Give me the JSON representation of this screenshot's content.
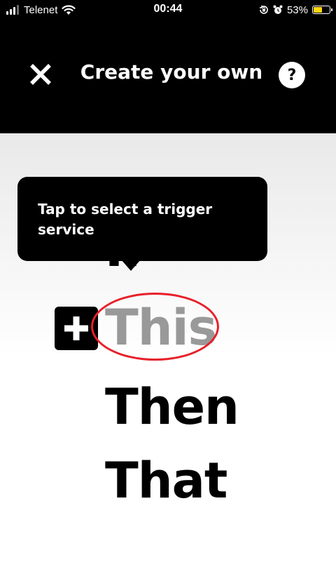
{
  "status_bar": {
    "carrier": "Telenet",
    "time": "00:44",
    "battery_percent": "53%",
    "battery_level": 0.53,
    "battery_color": "#ffd60a",
    "icons": [
      "signal-icon",
      "wifi-icon",
      "rotation-lock-icon",
      "alarm-icon",
      "battery-icon"
    ]
  },
  "header": {
    "title": "Create your own",
    "close_icon": "close-icon",
    "help_label": "?"
  },
  "applet": {
    "if_word": "If",
    "this_word": "This",
    "then_word": "Then",
    "that_word": "That",
    "add_icon": "plus-icon"
  },
  "tooltip": {
    "text": "Tap to select a trigger service"
  },
  "colors": {
    "header_background": "#000000",
    "this_text": "#999999",
    "highlight_ring": "#e8202a"
  }
}
